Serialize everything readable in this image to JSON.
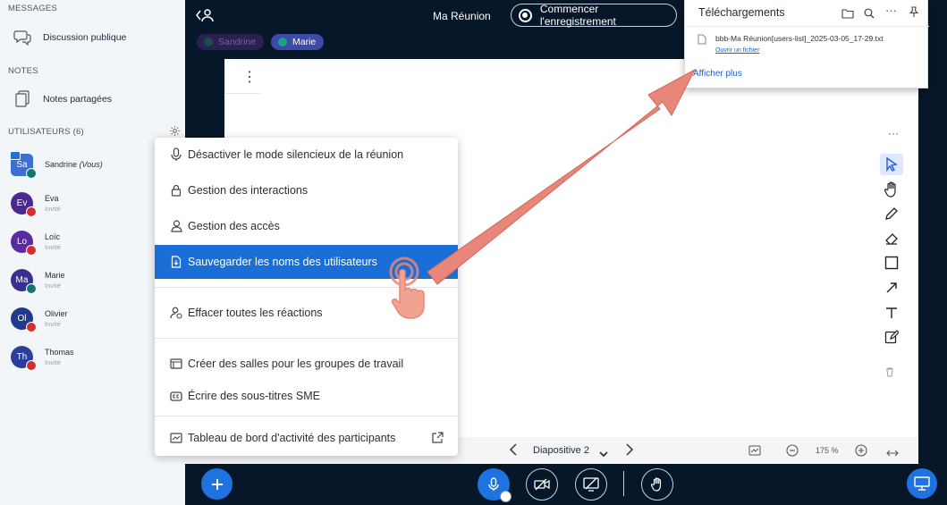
{
  "sidebar": {
    "messages_title": "MESSAGES",
    "public_chat": "Discussion publique",
    "notes_title": "NOTES",
    "shared_notes": "Notes partagées",
    "users_title": "UTILISATEURS (6)",
    "users": [
      {
        "initials": "Sa",
        "name": "Sandrine",
        "suffix": "(Vous)",
        "role": "",
        "color": "#3b6fd1",
        "mic": "on"
      },
      {
        "initials": "Ev",
        "name": "Eva",
        "suffix": "",
        "role": "Invité",
        "color": "#4a2a8c",
        "mic": "off"
      },
      {
        "initials": "Lo",
        "name": "Loïc",
        "suffix": "",
        "role": "Invité",
        "color": "#5a2ca0",
        "mic": "off"
      },
      {
        "initials": "Ma",
        "name": "Marie",
        "suffix": "",
        "role": "Invité",
        "color": "#3a2f8f",
        "mic": "on"
      },
      {
        "initials": "Ol",
        "name": "Olivier",
        "suffix": "",
        "role": "Invité",
        "color": "#1f3a8f",
        "mic": "off"
      },
      {
        "initials": "Th",
        "name": "Thomas",
        "suffix": "",
        "role": "Invité",
        "color": "#2a3f9a",
        "mic": "off"
      }
    ]
  },
  "topbar": {
    "meeting_title": "Ma Réunion",
    "record_label": "Commencer l'enregistrement",
    "talkers": [
      "Sandrine",
      "Marie"
    ]
  },
  "menu": {
    "items": [
      {
        "label": "Désactiver le mode silencieux de la réunion",
        "icon": "microphone-icon"
      },
      {
        "label": "Gestion des interactions",
        "icon": "lock-icon"
      },
      {
        "label": "Gestion des accès",
        "icon": "user-icon"
      },
      {
        "label": "Sauvegarder les noms des utilisateurs",
        "icon": "save-file-icon"
      },
      {
        "label": "Effacer toutes les réactions",
        "icon": "clear-reactions-icon"
      },
      {
        "label": "Créer des salles pour les groupes de travail",
        "icon": "breakout-rooms-icon"
      },
      {
        "label": "Écrire des sous-titres SME",
        "icon": "closed-captions-icon"
      },
      {
        "label": "Tableau de bord d'activité des participants",
        "icon": "dashboard-icon"
      }
    ]
  },
  "downloads": {
    "title": "Téléchargements",
    "file_name": "bbb-Ma Réunion[users-list]_2025-03-05_17-29.txt",
    "open_file": "Ouvrir un fichier",
    "show_more": "Afficher plus"
  },
  "slidebar": {
    "slide_label": "Diapositive 2",
    "zoom": "175 %"
  },
  "colors": {
    "accent": "#1b6ed6",
    "dark_bg": "#06172a",
    "arrow": "#e8867a"
  }
}
